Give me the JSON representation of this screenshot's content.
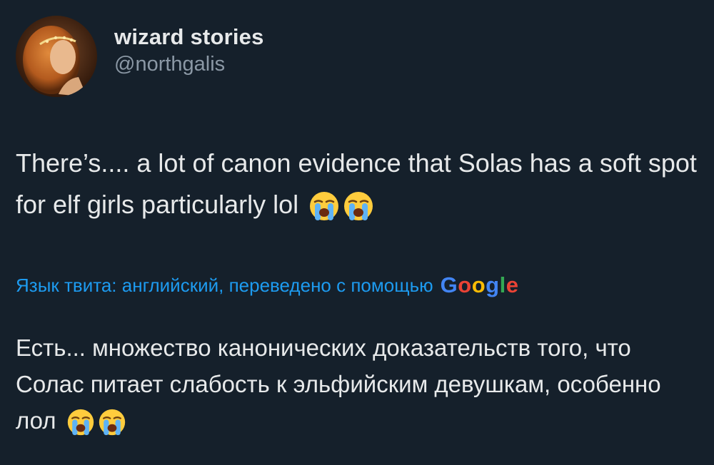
{
  "author": {
    "display_name": "wizard stories",
    "handle": "@northgalis"
  },
  "tweet": {
    "text": "There’s.... a lot of canon evidence that Solas has a soft spot for elf girls particularly lol",
    "emojis": [
      "loudly-crying-face",
      "loudly-crying-face"
    ]
  },
  "translation": {
    "note": "Язык твита: английский, переведено с помощью",
    "provider_logo": [
      "G",
      "o",
      "o",
      "g",
      "l",
      "e"
    ],
    "text": "Есть... множество канонических доказательств того, что Солас питает слабость к эльфийским девушкам, особенно лол",
    "emojis": [
      "loudly-crying-face",
      "loudly-crying-face"
    ]
  },
  "colors": {
    "background": "#15202b",
    "text": "#e7e9ea",
    "secondary_text": "#8b98a5",
    "link": "#1d9bf0"
  }
}
